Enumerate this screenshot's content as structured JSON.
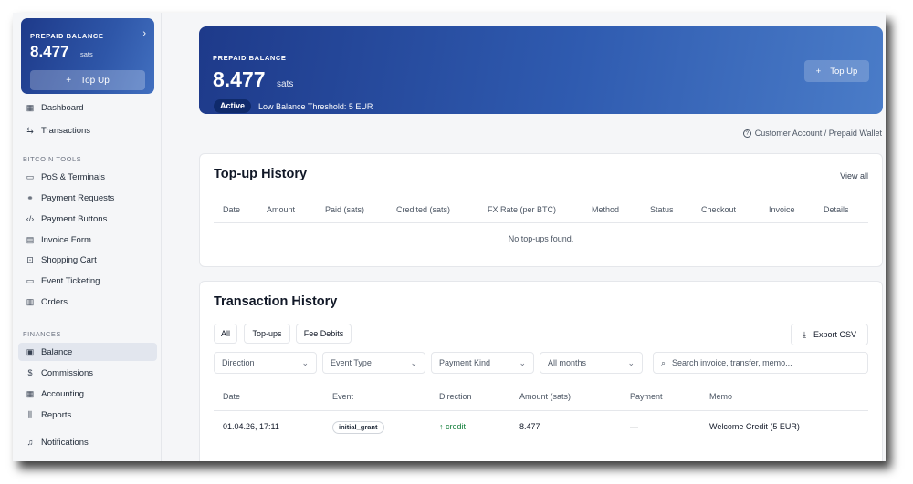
{
  "sidebar": {
    "balance_card": {
      "label": "PREPAID BALANCE",
      "amount": "8.477",
      "unit": "sats",
      "topup_label": "Top Up"
    },
    "main_items": [
      {
        "label": "Dashboard",
        "icon": "grid-icon"
      },
      {
        "label": "Transactions",
        "icon": "arrows-icon"
      }
    ],
    "bitcoin_tools_header": "BITCOIN TOOLS",
    "bitcoin_tools": [
      {
        "label": "PoS & Terminals",
        "icon": "monitor-icon"
      },
      {
        "label": "Payment Requests",
        "icon": "link-icon"
      },
      {
        "label": "Payment Buttons",
        "icon": "code-icon"
      },
      {
        "label": "Invoice Form",
        "icon": "document-icon"
      },
      {
        "label": "Shopping Cart",
        "icon": "cart-icon"
      },
      {
        "label": "Event Ticketing",
        "icon": "ticket-icon"
      },
      {
        "label": "Orders",
        "icon": "receipt-icon"
      }
    ],
    "finances_header": "FINANCES",
    "finances": [
      {
        "label": "Balance",
        "icon": "wallet-icon"
      },
      {
        "label": "Commissions",
        "icon": "dollar-icon"
      },
      {
        "label": "Accounting",
        "icon": "calculator-icon"
      },
      {
        "label": "Reports",
        "icon": "chart-icon"
      }
    ],
    "notifications": {
      "label": "Notifications",
      "icon": "bell-icon"
    }
  },
  "hero": {
    "label": "PREPAID BALANCE",
    "amount": "8.477",
    "unit": "sats",
    "status": "Active",
    "threshold": "Low Balance Threshold: 5 EUR",
    "topup_label": "Top Up"
  },
  "breadcrumb": "Customer Account / Prepaid Wallet",
  "topup_history": {
    "title": "Top-up History",
    "view_all": "View all",
    "columns": [
      "Date",
      "Amount",
      "Paid (sats)",
      "Credited (sats)",
      "FX Rate (per BTC)",
      "Method",
      "Status",
      "Checkout",
      "Invoice",
      "Details"
    ],
    "empty_text": "No top-ups found."
  },
  "transaction_history": {
    "title": "Transaction History",
    "filter_chips": [
      "All",
      "Top-ups",
      "Fee Debits"
    ],
    "export_label": "Export CSV",
    "selects": [
      "Direction",
      "Event Type",
      "Payment Kind",
      "All months"
    ],
    "search_placeholder": "Search invoice, transfer, memo...",
    "columns": [
      "Date",
      "Event",
      "Direction",
      "Amount (sats)",
      "Payment",
      "Memo"
    ],
    "rows": [
      {
        "date": "01.04.26, 17:11",
        "event": "initial_grant",
        "direction": "↑ credit",
        "amount": "8.477",
        "payment": "—",
        "memo": "Welcome Credit (5 EUR)"
      }
    ]
  },
  "colors": {
    "brand": "#1e3a8a",
    "credit": "#15803d"
  }
}
